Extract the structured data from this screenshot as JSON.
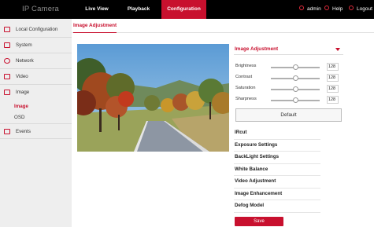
{
  "header": {
    "brand": "IP Camera",
    "nav": [
      {
        "label": "Live View",
        "active": false
      },
      {
        "label": "Playback",
        "active": false
      },
      {
        "label": "Configuration",
        "active": true
      }
    ],
    "user": "admin",
    "help": "Help",
    "logout": "Logout"
  },
  "sidebar": {
    "items": [
      {
        "label": "Local Configuration",
        "icon": "monitor-icon"
      },
      {
        "label": "System",
        "icon": "system-icon"
      },
      {
        "label": "Network",
        "icon": "network-icon"
      },
      {
        "label": "Video",
        "icon": "video-icon"
      },
      {
        "label": "Image",
        "icon": "image-icon"
      }
    ],
    "sub_items": [
      {
        "label": "Image",
        "active": true
      },
      {
        "label": "OSD",
        "active": false
      }
    ],
    "events": {
      "label": "Events",
      "icon": "events-icon"
    }
  },
  "tab": {
    "label": "Image Adjustment"
  },
  "panel": {
    "title": "Image Adjustment",
    "sliders": [
      {
        "label": "Brightness",
        "value": "128",
        "level": 0.5
      },
      {
        "label": "Contrast",
        "value": "128",
        "level": 0.5
      },
      {
        "label": "Saturation",
        "value": "128",
        "level": 0.5
      },
      {
        "label": "Sharpness",
        "value": "128",
        "level": 0.5
      }
    ],
    "default_label": "Default",
    "sections": [
      "IRcut",
      "Exposure Settings",
      "BackLight Settings",
      "White Balance",
      "Video Adjustment",
      "Image Enhancement",
      "Defog Model"
    ],
    "save_label": "Save"
  },
  "colors": {
    "accent": "#c8102e",
    "topbar": "#000000",
    "sidebar_bg": "#eeeeee"
  }
}
